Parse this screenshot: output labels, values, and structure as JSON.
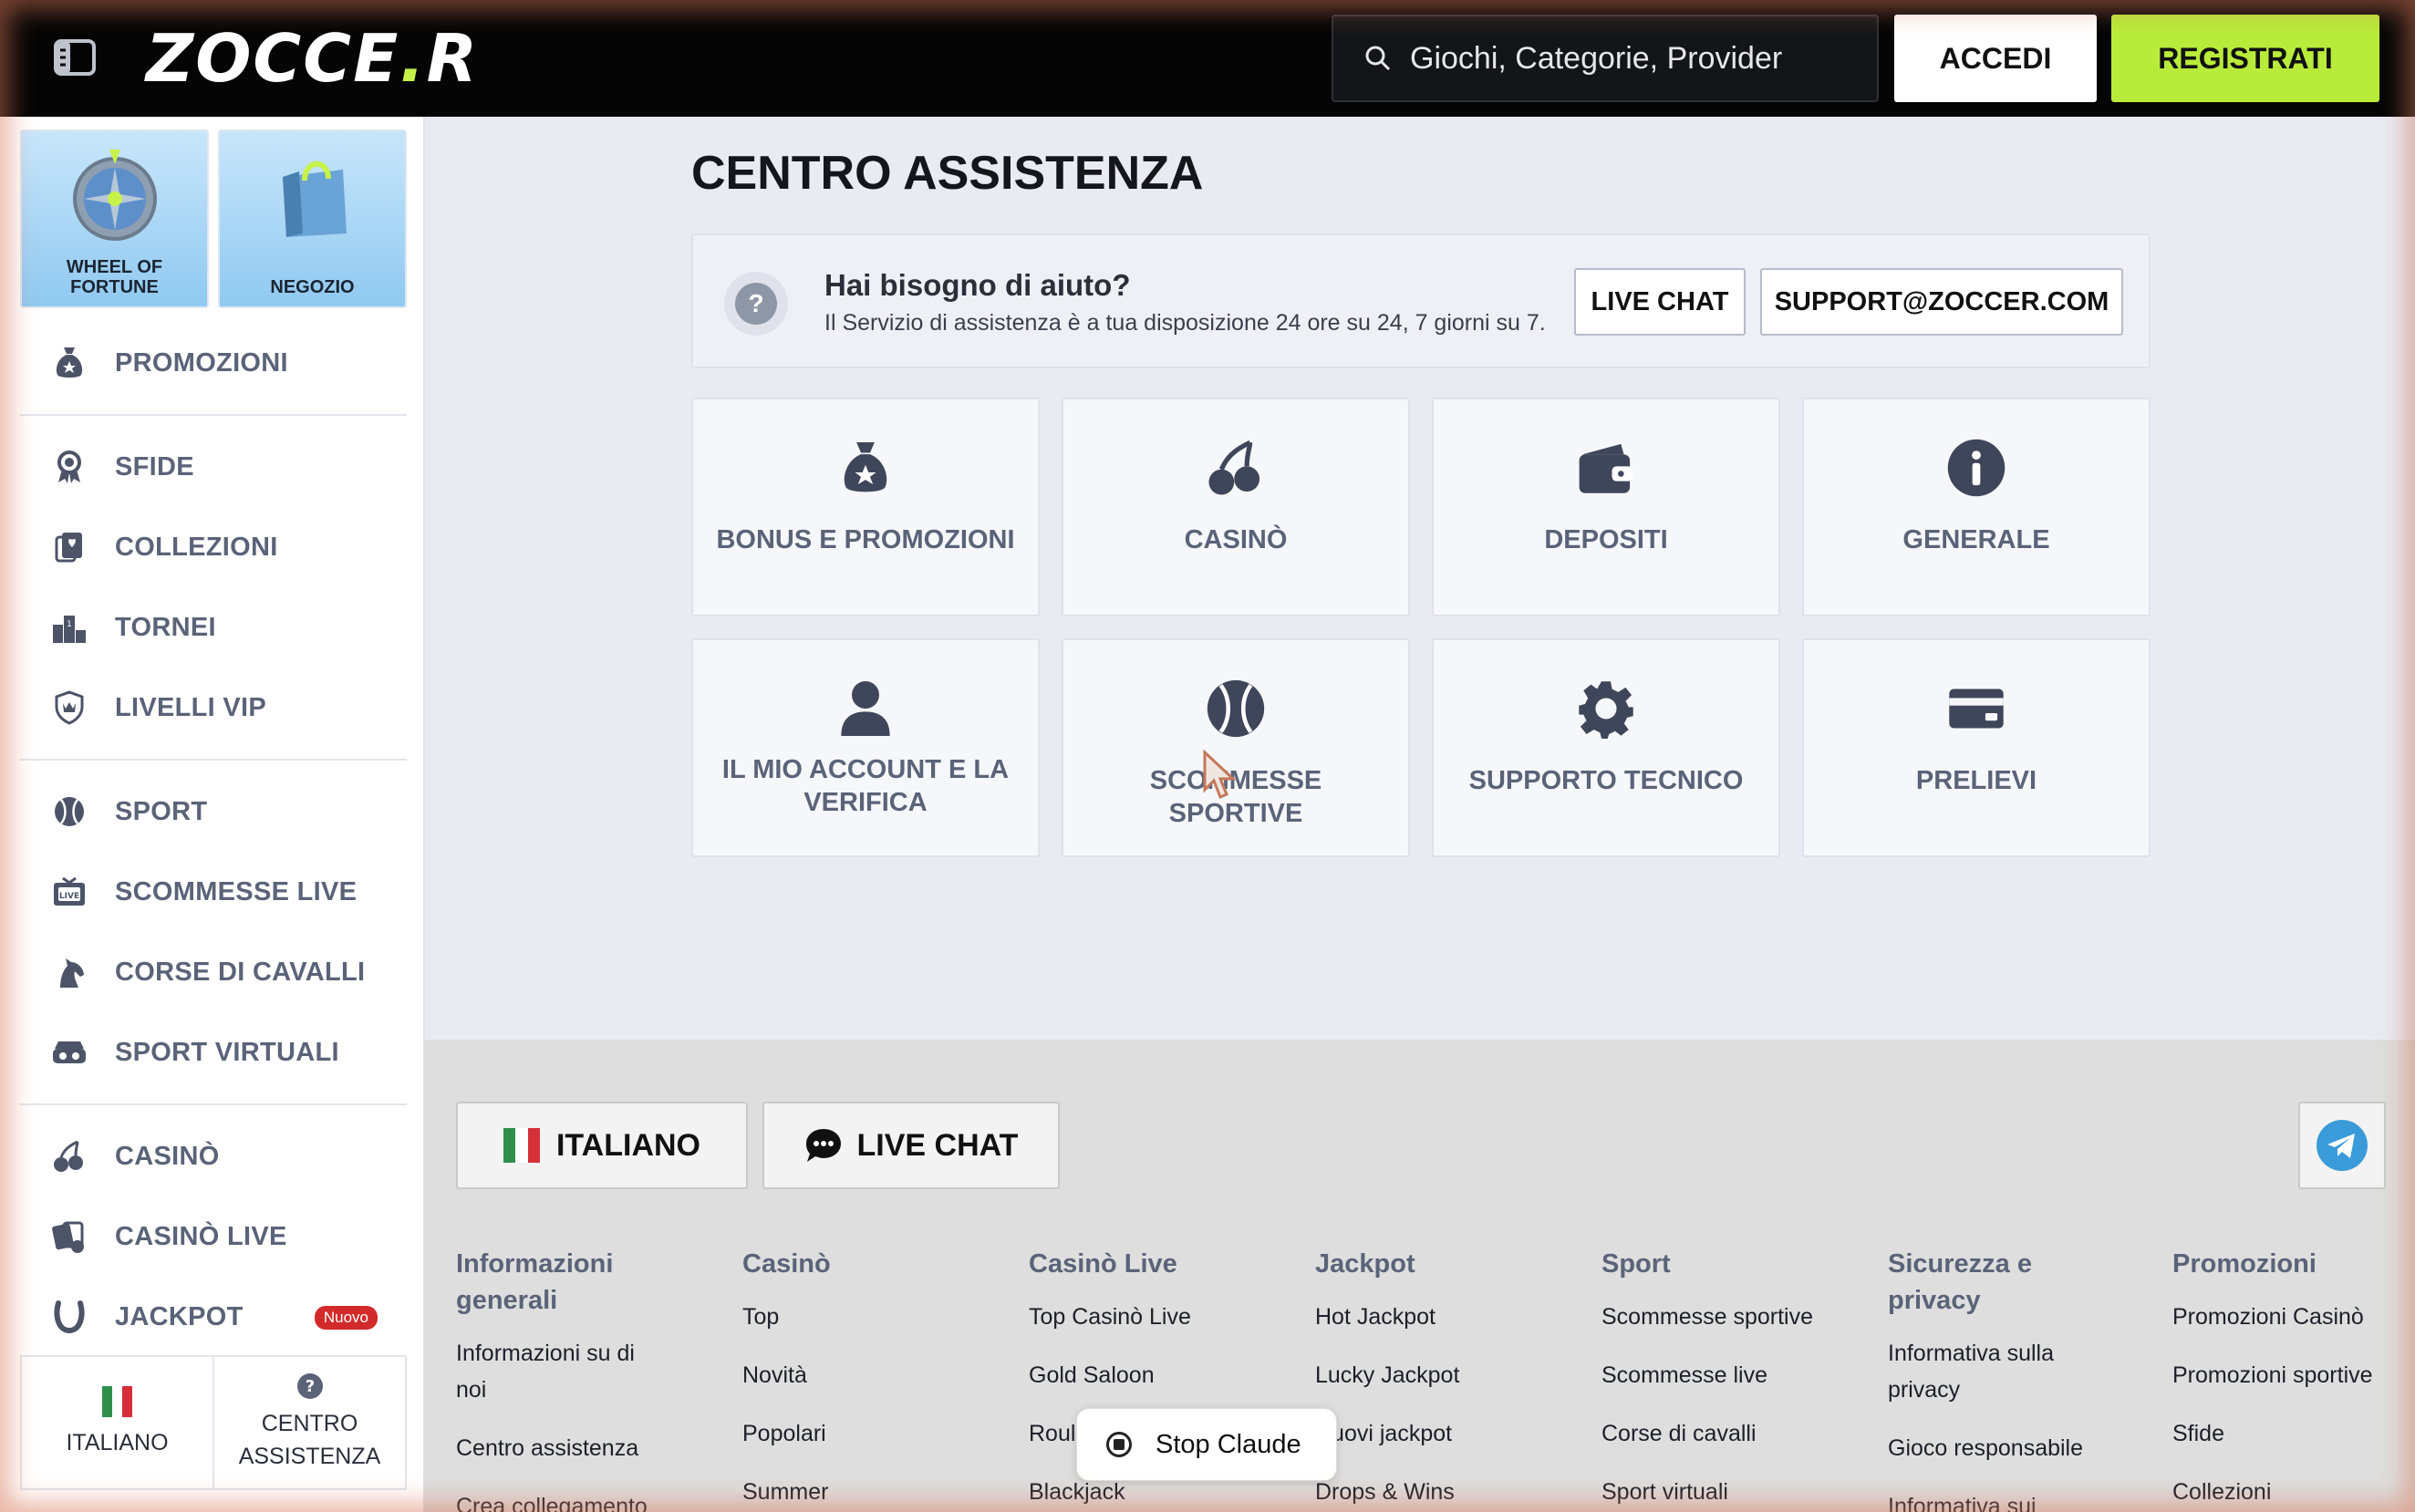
{
  "header": {
    "logo_main": "ZOCCE",
    "logo_end": "R",
    "search_placeholder": "Giochi, Categorie, Provider",
    "login_label": "ACCEDI",
    "register_label": "REGISTRATI"
  },
  "sidebar": {
    "tiles": [
      {
        "label": "WHEEL OF FORTUNE"
      },
      {
        "label": "NEGOZIO"
      }
    ],
    "items": [
      {
        "label": "PROMOZIONI",
        "icon": "moneybag-icon"
      },
      {
        "label": "SFIDE",
        "icon": "award-icon"
      },
      {
        "label": "COLLEZIONI",
        "icon": "cards-icon"
      },
      {
        "label": "TORNEI",
        "icon": "podium-icon"
      },
      {
        "label": "LIVELLI VIP",
        "icon": "shield-crown-icon"
      },
      {
        "label": "SPORT",
        "icon": "baseball-icon"
      },
      {
        "label": "SCOMMESSE LIVE",
        "icon": "live-tv-icon"
      },
      {
        "label": "CORSE DI CAVALLI",
        "icon": "horse-icon"
      },
      {
        "label": "SPORT VIRTUALI",
        "icon": "vr-headset-icon"
      },
      {
        "label": "CASINÒ",
        "icon": "cherries-icon"
      },
      {
        "label": "CASINÒ LIVE",
        "icon": "live-cards-icon"
      },
      {
        "label": "JACKPOT",
        "icon": "horseshoe-icon",
        "badge": "Nuovo"
      }
    ],
    "bottom": {
      "language": "ITALIANO",
      "help_line1": "CENTRO",
      "help_line2": "ASSISTENZA"
    }
  },
  "main": {
    "title": "CENTRO ASSISTENZA",
    "help": {
      "title": "Hai bisogno di aiuto?",
      "subtitle": "Il Servizio di assistenza è a tua disposizione 24 ore su 24, 7 giorni su 7.",
      "live_chat": "LIVE CHAT",
      "email": "SUPPORT@ZOCCER.COM"
    },
    "categories": [
      {
        "label": "BONUS E PROMOZIONI",
        "icon": "moneybag-icon"
      },
      {
        "label": "CASINÒ",
        "icon": "cherries-icon"
      },
      {
        "label": "DEPOSITI",
        "icon": "wallet-icon"
      },
      {
        "label": "GENERALE",
        "icon": "info-icon"
      },
      {
        "label": "IL MIO ACCOUNT E LA VERIFICA",
        "icon": "user-icon"
      },
      {
        "label": "SCOMMESSE SPORTIVE",
        "icon": "baseball-icon"
      },
      {
        "label": "SUPPORTO TECNICO",
        "icon": "gear-icon"
      },
      {
        "label": "PRELIEVI",
        "icon": "credit-card-icon"
      }
    ]
  },
  "footer": {
    "language": "ITALIANO",
    "live_chat": "LIVE CHAT",
    "columns": [
      {
        "heading": "Informazioni generali",
        "links": [
          "Informazioni su di noi",
          "Centro assistenza",
          "Crea collegamento"
        ]
      },
      {
        "heading": "Casinò",
        "links": [
          "Top",
          "Novità",
          "Popolari",
          "Summer"
        ]
      },
      {
        "heading": "Casinò Live",
        "links": [
          "Top Casinò Live",
          "Gold Saloon",
          "Roulette",
          "Blackjack"
        ]
      },
      {
        "heading": "Jackpot",
        "links": [
          "Hot Jackpot",
          "Lucky Jackpot",
          "Nuovi jackpot",
          "Drops & Wins"
        ]
      },
      {
        "heading": "Sport",
        "links": [
          "Scommesse sportive",
          "Scommesse live",
          "Corse di cavalli",
          "Sport virtuali"
        ]
      },
      {
        "heading": "Sicurezza e privacy",
        "links": [
          "Informativa sulla privacy",
          "Gioco responsabile",
          "Informativa sui"
        ]
      },
      {
        "heading": "Promozioni",
        "links": [
          "Promozioni Casinò",
          "Promozioni sportive",
          "Sfide",
          "Collezioni"
        ]
      }
    ]
  },
  "overlay": {
    "stop_label": "Stop Claude"
  },
  "colors": {
    "accent": "#b9ec3a",
    "header_bg": "#050505",
    "nav_text": "#5b6379",
    "badge_red": "#d22a2a"
  }
}
